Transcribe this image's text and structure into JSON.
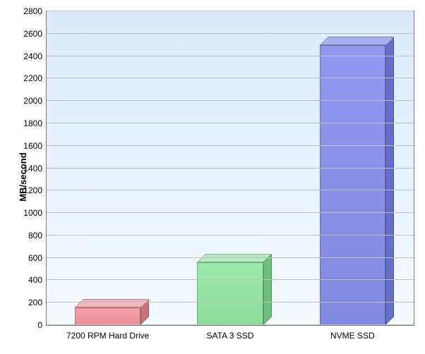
{
  "chart_data": {
    "type": "bar",
    "categories": [
      "7200 RPM Hard Drive",
      "SATA 3 SSD",
      "NVME SSD"
    ],
    "values": [
      160,
      560,
      2500
    ],
    "title": "",
    "xlabel": "",
    "ylabel": "MB/second",
    "ylim": [
      0,
      2800
    ],
    "ytick_step": 200,
    "colors": {
      "bar_fills": [
        "#e8919a",
        "#8ddc9d",
        "#7f8ae0"
      ],
      "bar_tops": [
        "#f2b5bb",
        "#b4ebbf",
        "#a8afec"
      ],
      "bar_sides": [
        "#c9737d",
        "#6fc07e",
        "#646fc9"
      ]
    }
  }
}
